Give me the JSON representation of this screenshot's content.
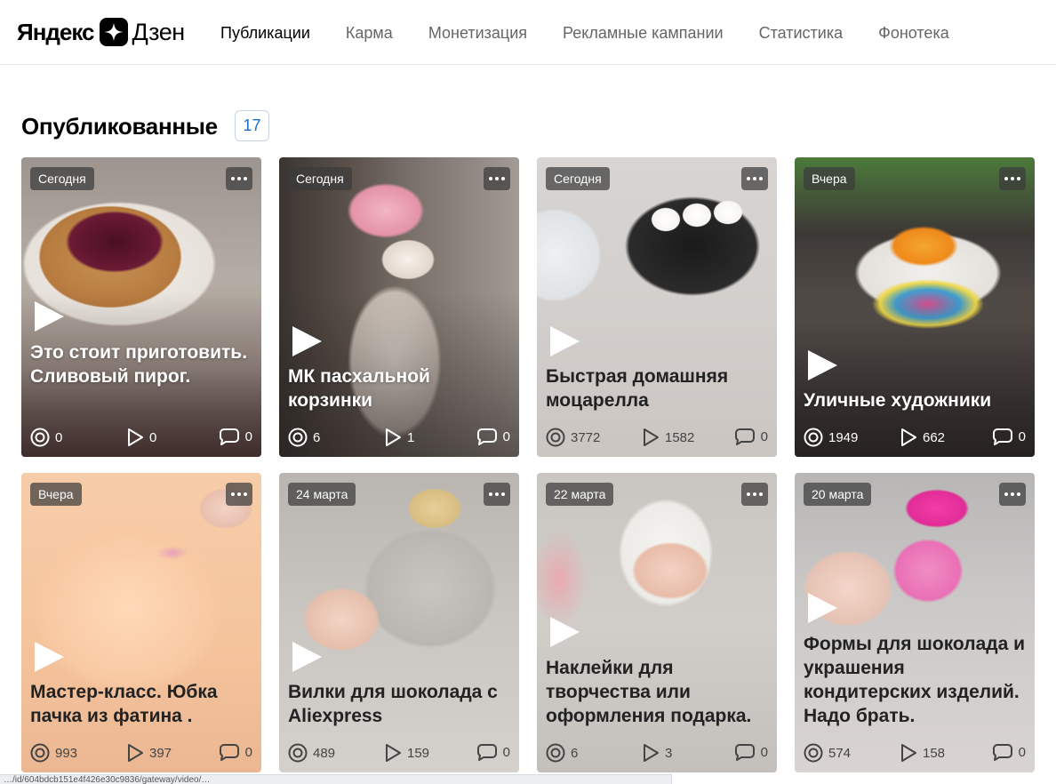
{
  "header": {
    "logo_yandex": "Яндекс",
    "logo_dzen": "Дзен",
    "nav": [
      {
        "label": "Публикации",
        "active": true
      },
      {
        "label": "Карма",
        "active": false
      },
      {
        "label": "Монетизация",
        "active": false
      },
      {
        "label": "Рекламные кампании",
        "active": false
      },
      {
        "label": "Статистика",
        "active": false
      },
      {
        "label": "Фонотека",
        "active": false
      }
    ]
  },
  "section": {
    "title": "Опубликованные",
    "count": "17"
  },
  "icons": {
    "views": "eye-circle-icon",
    "plays": "play-outline-icon",
    "comments": "comment-bubble-icon",
    "more": "three-dots-icon",
    "play": "play-triangle-icon"
  },
  "colors": {
    "badge_text": "#1a6fcf",
    "nav_inactive": "#666666",
    "nav_active": "#000000"
  },
  "cards": [
    {
      "date": "Сегодня",
      "title": "Это стоит приготовить. Сливовый пирог.",
      "views": "0",
      "plays": "0",
      "comments": "0"
    },
    {
      "date": "Сегодня",
      "title": "МК пасхальной корзинки",
      "views": "6",
      "plays": "1",
      "comments": "0"
    },
    {
      "date": "Сегодня",
      "title": "Быстрая домашняя моцарелла",
      "views": "3772",
      "plays": "1582",
      "comments": "0"
    },
    {
      "date": "Вчера",
      "title": "Уличные художники",
      "views": "1949",
      "plays": "662",
      "comments": "0"
    },
    {
      "date": "Вчера",
      "title": "Мастер-класс. Юбка пачка из фатина .",
      "views": "993",
      "plays": "397",
      "comments": "0"
    },
    {
      "date": "24 марта",
      "title": "Вилки для шоколада с Aliexpress",
      "views": "489",
      "plays": "159",
      "comments": "0"
    },
    {
      "date": "22 марта",
      "title": "Наклейки для творчества или оформления подарка.",
      "views": "6",
      "plays": "3",
      "comments": "0"
    },
    {
      "date": "20 марта",
      "title": "Формы для шоколада и украшения кондитерских изделий. Надо брать.",
      "views": "574",
      "plays": "158",
      "comments": "0"
    }
  ],
  "status_bar": {
    "url": "…/id/604bdcb151e4f426e30c9836/gateway/video/…"
  }
}
